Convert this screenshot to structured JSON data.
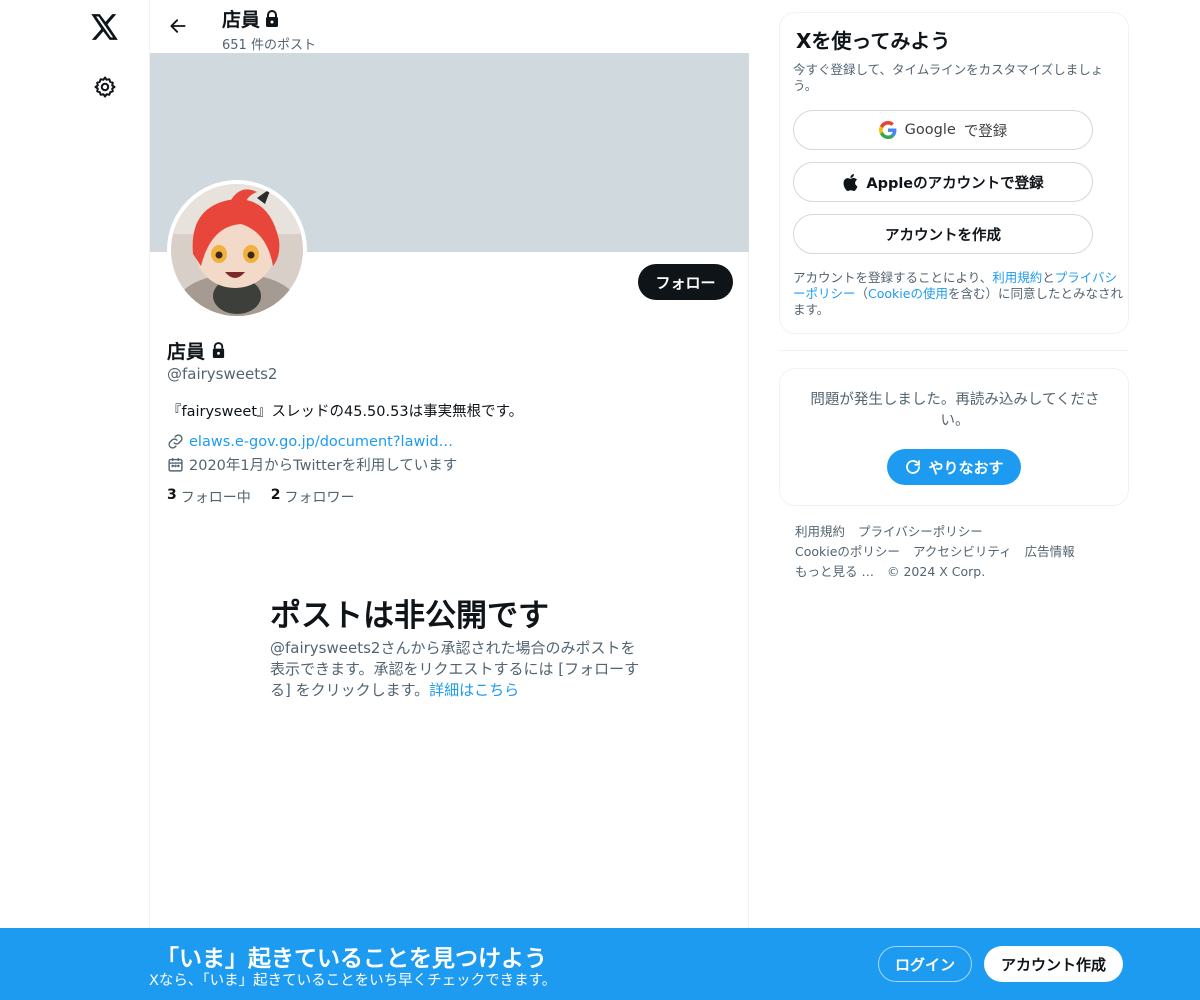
{
  "header": {
    "title": "店員",
    "post_count": "651 件のポスト"
  },
  "profile": {
    "name": "店員",
    "handle": "@fairysweets2",
    "bio": "『fairysweet』スレッドの45.50.53は事実無根です。",
    "link": "elaws.e-gov.go.jp/document?lawid…",
    "joined": "2020年1月からTwitterを利用しています",
    "following_count": "3",
    "following_label": "フォロー中",
    "followers_count": "2",
    "followers_label": "フォロワー",
    "follow_button": "フォロー"
  },
  "private": {
    "title": "ポストは非公開です",
    "description": "@fairysweets2さんから承認された場合のみポストを表示できます。承認をリクエストするには [フォローする] をクリックします。",
    "learn_more": "詳細はこちら"
  },
  "signup": {
    "title": "Xを使ってみよう",
    "subtitle": "今すぐ登録して、タイムラインをカスタマイズしましょう。",
    "google_brand": "Google",
    "google_suffix": "で登録",
    "apple_label": "Appleのアカウントで登録",
    "create_label": "アカウントを作成",
    "terms_prefix": "アカウントを登録することにより、",
    "terms_link": "利用規約",
    "terms_and": "と",
    "privacy_link": "プライバシーポリシー",
    "terms_open": "（",
    "cookie_link": "Cookieの使用",
    "terms_suffix": "を含む）に同意したとみなされます。"
  },
  "error": {
    "message": "問題が発生しました。再読み込みしてください。",
    "retry_label": "やりなおす"
  },
  "footer": {
    "terms": "利用規約",
    "privacy": "プライバシーポリシー",
    "cookie": "Cookieのポリシー",
    "accessibility": "アクセシビリティ",
    "ads": "広告情報",
    "more": "もっと見る …",
    "copyright": "© 2024 X Corp."
  },
  "bottom_bar": {
    "title": "「いま」起きていることを見つけよう",
    "subtitle": "Xなら、「いま」起きていることをいち早くチェックできます。",
    "login_label": "ログイン",
    "create_label": "アカウント作成"
  },
  "icons": {
    "logo": "x-logo-icon",
    "settings": "gear-icon",
    "back": "arrow-left-icon",
    "lock": "lock-icon",
    "link": "link-icon",
    "calendar": "calendar-icon",
    "google": "google-icon",
    "apple": "apple-icon",
    "retry": "refresh-icon"
  },
  "colors": {
    "accent": "#1d9bf0",
    "text": "#0f1419",
    "muted": "#536471",
    "banner": "#cfd9de"
  }
}
